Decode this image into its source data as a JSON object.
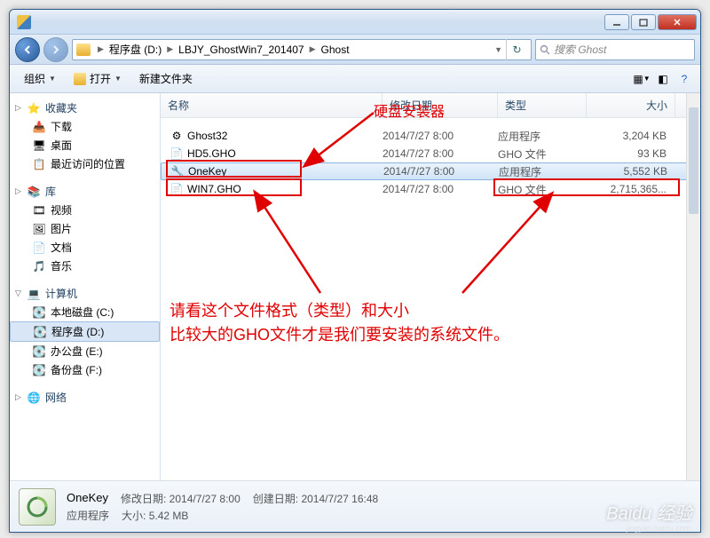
{
  "breadcrumb": {
    "parts": [
      "程序盘 (D:)",
      "LBJY_GhostWin7_201407",
      "Ghost"
    ]
  },
  "search": {
    "placeholder": "搜索 Ghost"
  },
  "toolbar": {
    "organize": "组织",
    "open": "打开",
    "newfolder": "新建文件夹"
  },
  "columns": {
    "name": "名称",
    "date": "修改日期",
    "type": "类型",
    "size": "大小"
  },
  "sidebar": {
    "favorites": "收藏夹",
    "downloads": "下载",
    "desktop": "桌面",
    "recent": "最近访问的位置",
    "libraries": "库",
    "videos": "视频",
    "pictures": "图片",
    "documents": "文档",
    "music": "音乐",
    "computer": "计算机",
    "localc": "本地磁盘 (C:)",
    "progd": "程序盘 (D:)",
    "officee": "办公盘 (E:)",
    "backupf": "备份盘 (F:)",
    "network": "网络"
  },
  "files": [
    {
      "name": "Ghost32",
      "date": "2014/7/27 8:00",
      "type": "应用程序",
      "size": "3,204 KB",
      "icon": "exe"
    },
    {
      "name": "HD5.GHO",
      "date": "2014/7/27 8:00",
      "type": "GHO 文件",
      "size": "93 KB",
      "icon": "file"
    },
    {
      "name": "OneKey",
      "date": "2014/7/27 8:00",
      "type": "应用程序",
      "size": "5,552 KB",
      "icon": "app",
      "selected": true
    },
    {
      "name": "WIN7.GHO",
      "date": "2014/7/27 8:00",
      "type": "GHO 文件",
      "size": "2,715,365...",
      "icon": "file"
    }
  ],
  "annotations": {
    "label1": "硬盘安装器",
    "label2_l1": "请看这个文件格式（类型）和大小",
    "label2_l2": "比较大的GHO文件才是我们要安装的系统文件。"
  },
  "details": {
    "name": "OneKey",
    "mod_label": "修改日期:",
    "mod_value": "2014/7/27 8:00",
    "create_label": "创建日期:",
    "create_value": "2014/7/27 16:48",
    "type": "应用程序",
    "size_label": "大小:",
    "size_value": "5.42 MB"
  },
  "watermark": {
    "main": "Baidu 经验",
    "sub": "jingyan.baidu.com"
  }
}
